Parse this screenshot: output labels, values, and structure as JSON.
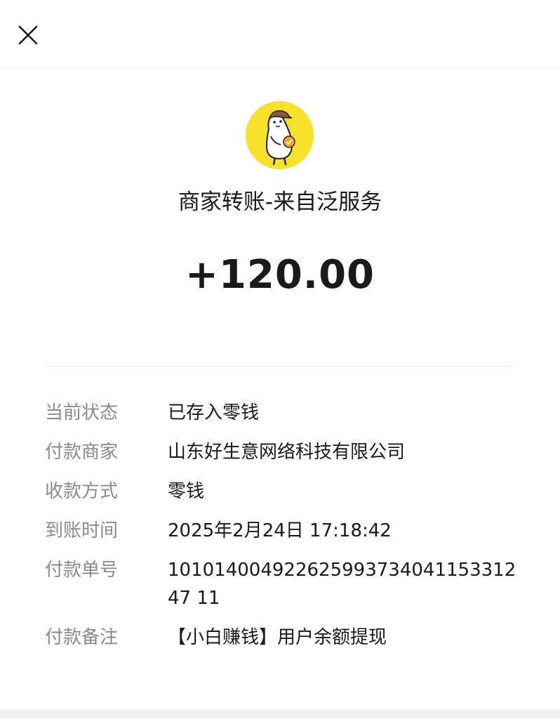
{
  "header": {
    "close_icon": "close-icon"
  },
  "merchant": {
    "avatar_icon": "mascot-avatar-icon",
    "avatar_color": "#f7e12a",
    "title": "商家转账-来自泛服务"
  },
  "amount": "+120.00",
  "details": [
    {
      "label": "当前状态",
      "value": "已存入零钱"
    },
    {
      "label": "付款商家",
      "value": "山东好生意网络科技有限公司"
    },
    {
      "label": "收款方式",
      "value": "零钱"
    },
    {
      "label": "到账时间",
      "value": "2025年2月24日 17:18:42"
    },
    {
      "label": "付款单号",
      "value": "10101400492262599373404115331247 11"
    },
    {
      "label": "付款备注",
      "value": "【小白赚钱】用户余额提现"
    }
  ]
}
